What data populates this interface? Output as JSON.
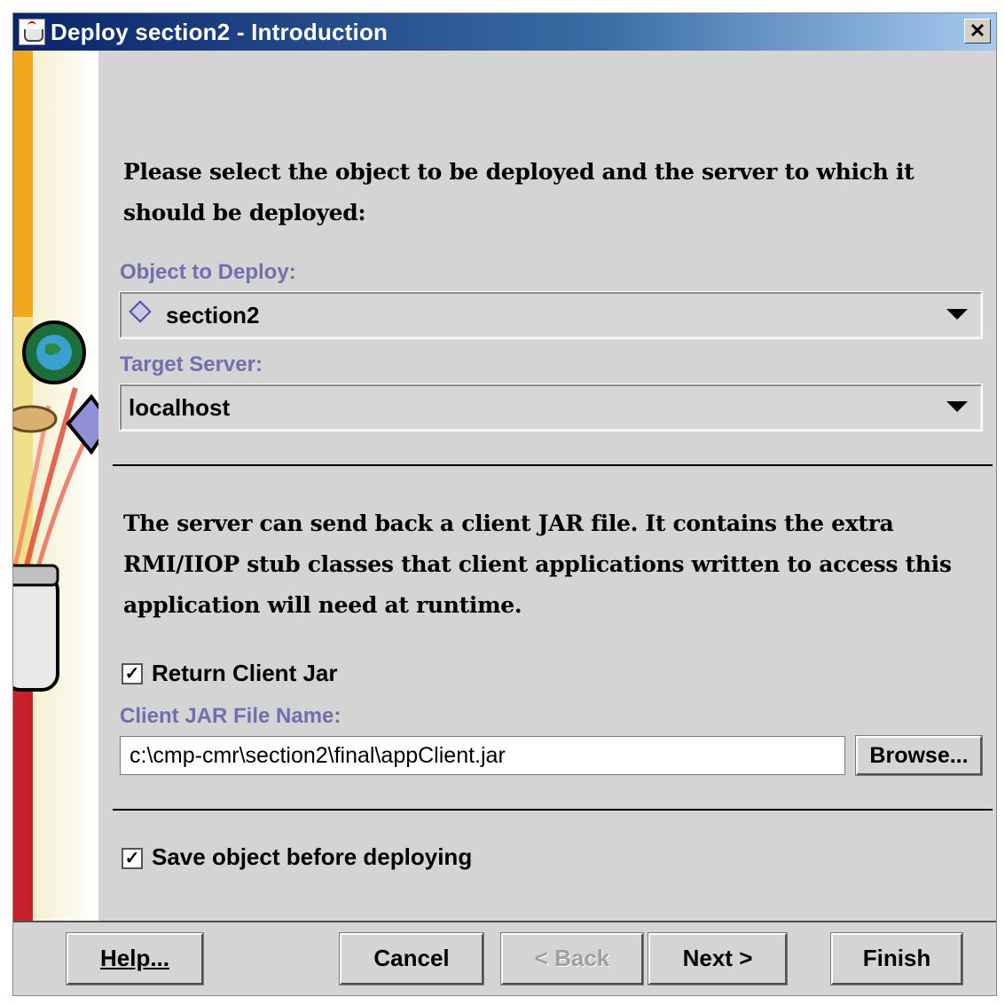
{
  "window": {
    "title": "Deploy section2 - Introduction",
    "close_glyph": "✕"
  },
  "intro": {
    "line1": "Please select the object to be deployed and the server to which it",
    "line2": "should be deployed:"
  },
  "object_to_deploy": {
    "label": "Object to Deploy:",
    "value": "section2",
    "icon": "diamond-icon"
  },
  "target_server": {
    "label": "Target Server:",
    "value": "localhost"
  },
  "client_jar_info": {
    "line1": "The server can send back a client JAR file. It contains the extra",
    "line2": "RMI/IIOP stub classes that client applications written to access this",
    "line3": "application will need at runtime."
  },
  "return_client_jar": {
    "label": "Return Client Jar",
    "checked": true
  },
  "client_jar_file": {
    "label": "Client JAR File Name:",
    "value": "c:\\cmp-cmr\\section2\\final\\appClient.jar",
    "browse_label": "Browse..."
  },
  "save_before_deploy": {
    "label": "Save object before deploying",
    "checked": true
  },
  "buttons": {
    "help": "Help...",
    "cancel": "Cancel",
    "back": "< Back",
    "next": "Next >",
    "finish": "Finish"
  },
  "colors": {
    "title_bar": "#0a246a",
    "section_label": "#7070b0",
    "panel_background": "#d4d4d4"
  }
}
